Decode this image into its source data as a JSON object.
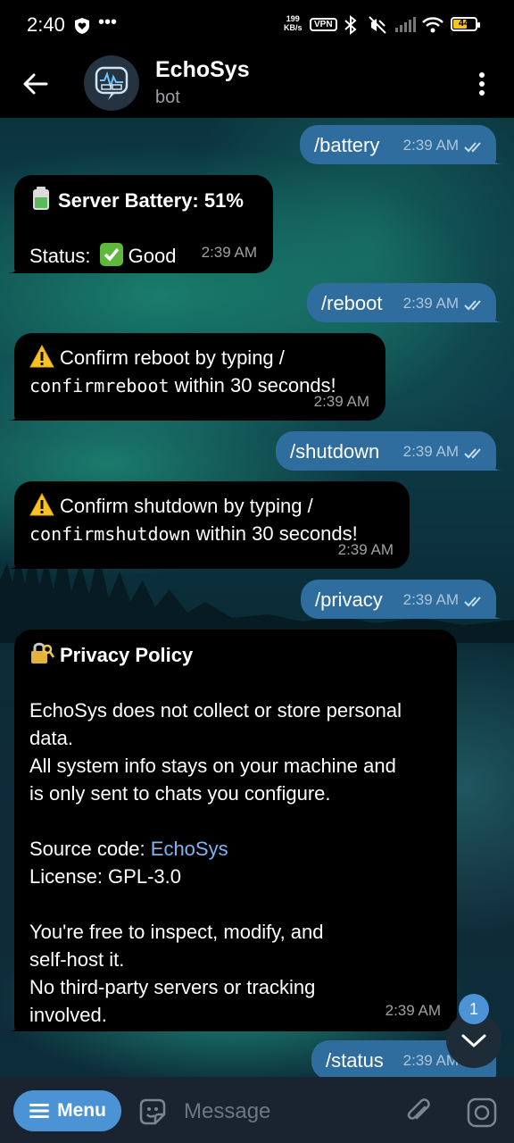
{
  "status_bar": {
    "time": "2:40",
    "speed_value": "199",
    "speed_unit": "KB/s",
    "vpn": "VPN",
    "battery": "44"
  },
  "header": {
    "title": "EchoSys",
    "subtitle": "bot"
  },
  "messages": [
    {
      "dir": "out",
      "text": "/battery",
      "time": "2:39 AM"
    },
    {
      "dir": "in",
      "emoji": "battery-icon",
      "title": "Server Battery: 51%",
      "body": "Status:",
      "status_emoji": "check-mark-icon",
      "status_text": "Good",
      "time": "2:39 AM"
    },
    {
      "dir": "out",
      "text": "/reboot",
      "time": "2:39 AM"
    },
    {
      "dir": "in",
      "emoji": "warning-icon",
      "text_a": "Confirm reboot by typing /",
      "cmd": "confirmreboot",
      "text_b": "within 30 seconds!",
      "time": "2:39 AM"
    },
    {
      "dir": "out",
      "text": "/shutdown",
      "time": "2:39 AM"
    },
    {
      "dir": "in",
      "emoji": "warning-icon",
      "text_a": "Confirm shutdown by typing /",
      "cmd": "confirmshutdown",
      "text_b": "within 30 seconds!",
      "time": "2:39 AM"
    },
    {
      "dir": "out",
      "text": "/privacy",
      "time": "2:39 AM"
    },
    {
      "dir": "in",
      "emoji": "lock-key-icon",
      "title": "Privacy Policy",
      "p1_line1": "EchoSys does not collect or store personal",
      "p1_line2": "data.",
      "p1_line3": "All system info stays on your machine and",
      "p1_line4": "is only sent to chats you configure.",
      "source_label": "Source code:",
      "source_link": "EchoSys",
      "license": "License: GPL-3.0",
      "p3_line1": "You're free to inspect, modify, and",
      "p3_line2": "self-host it.",
      "p3_line3": "No third-party servers or tracking",
      "p3_line4": "involved.",
      "time": "2:39 AM"
    },
    {
      "dir": "out",
      "text": "/status",
      "time": "2:39 AM"
    }
  ],
  "unread_badge": "1",
  "composer": {
    "menu_label": "Menu",
    "placeholder": "Message"
  },
  "colors": {
    "outgoing_bubble": "#2e6d9e",
    "incoming_bubble": "#000000",
    "accent": "#4c93d6",
    "link": "#82b4ee"
  }
}
